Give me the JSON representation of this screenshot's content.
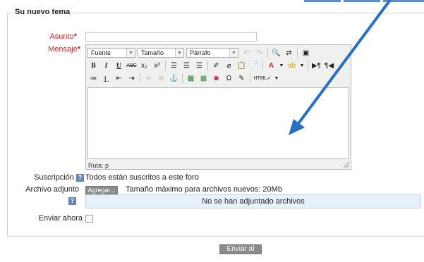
{
  "form": {
    "legend": "Su nuevo tema",
    "subject_label": "Asunto",
    "message_label": "Mensaje",
    "required_mark": "*",
    "subject_value": ""
  },
  "editor": {
    "font_dropdown": "Fuente",
    "size_dropdown": "Tamaño",
    "paragraph_dropdown": "Párrafo",
    "path_text": "Ruta: p",
    "buttons_row2": [
      "B",
      "I",
      "U",
      "ABC",
      "x₂",
      "x²"
    ]
  },
  "subscription": {
    "label": "Suscripción",
    "help": "?",
    "text": "Todos están suscritos a este foro"
  },
  "attachment": {
    "label": "Archivo adjunto",
    "help": "?",
    "add_button": "Agregar...",
    "max_size_text": "Tamaño máximo para archivos nuevos: 20Mb",
    "empty_text": "No se han adjuntado archivos"
  },
  "send_now": {
    "label": "Enviar ahora"
  },
  "submit": {
    "label": "Enviar al foro"
  },
  "colors": {
    "required": "#c8272b",
    "help_icon": "#6585b9",
    "annotation_arrow": "#2a6fc0",
    "files_box_bg": "#e7f1fb"
  }
}
